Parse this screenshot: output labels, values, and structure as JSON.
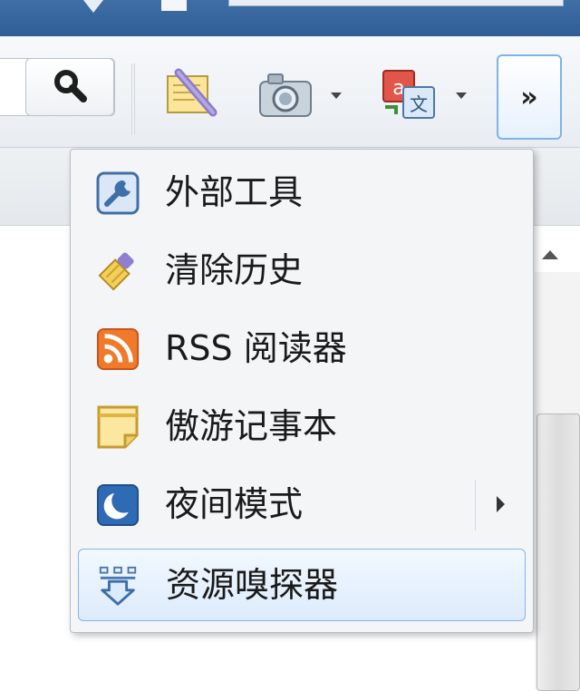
{
  "toolbar": {
    "more_label": "»"
  },
  "menu": {
    "items": [
      {
        "label": "外部工具",
        "icon": "wrench-icon"
      },
      {
        "label": "清除历史",
        "icon": "broom-icon"
      },
      {
        "label": "RSS 阅读器",
        "icon": "rss-icon"
      },
      {
        "label": "傲游记事本",
        "icon": "notepad-icon"
      },
      {
        "label": "夜间模式",
        "icon": "moon-icon",
        "has_submenu": true
      },
      {
        "label": "资源嗅探器",
        "icon": "sniffer-icon",
        "highlighted": true
      }
    ]
  },
  "colors": {
    "accent": "#7db4ea",
    "rss": "#f07a2a",
    "night": "#2f6bb5",
    "note": "#f6d56a"
  }
}
